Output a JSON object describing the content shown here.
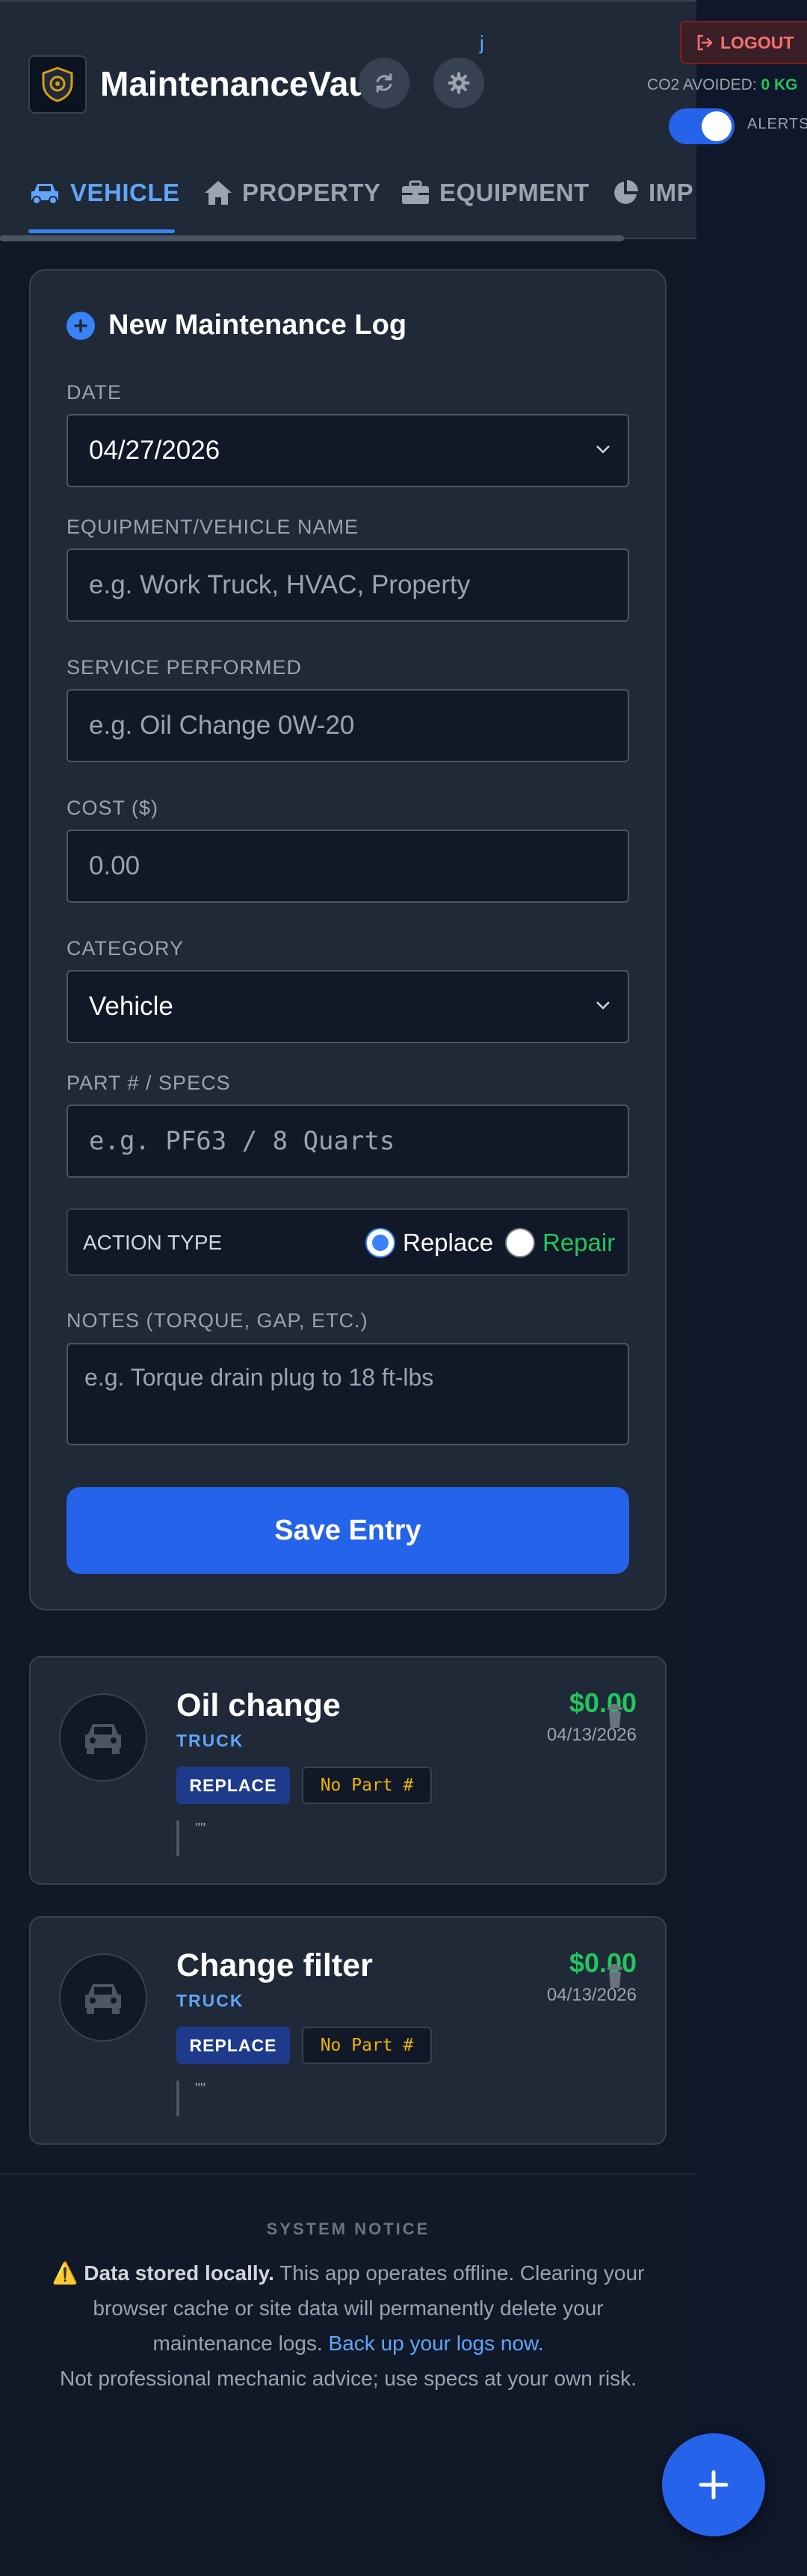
{
  "header": {
    "app_title": "MaintenanceVault",
    "user_initial": "j",
    "logout_label": "LOGOUT",
    "co2_label": "CO2 AVOIDED:",
    "co2_value": "0 KG",
    "alerts_label": "ALERTS",
    "alerts_enabled": true
  },
  "tabs": [
    {
      "label": "VEHICLE",
      "icon": "car-icon",
      "active": true
    },
    {
      "label": "PROPERTY",
      "icon": "home-icon",
      "active": false
    },
    {
      "label": "EQUIPMENT",
      "icon": "toolbox-icon",
      "active": false
    },
    {
      "label": "IMP",
      "icon": "pie-chart-icon",
      "active": false
    }
  ],
  "form": {
    "title": "New Maintenance Log",
    "date_label": "DATE",
    "date_value": "04/27/2026",
    "name_label": "EQUIPMENT/VEHICLE NAME",
    "name_placeholder": "e.g. Work Truck, HVAC, Property",
    "service_label": "SERVICE PERFORMED",
    "service_placeholder": "e.g. Oil Change 0W-20",
    "cost_label": "COST ($)",
    "cost_placeholder": "0.00",
    "category_label": "CATEGORY",
    "category_value": "Vehicle",
    "part_label": "PART # / SPECS",
    "part_placeholder": "e.g. PF63 / 8 Quarts",
    "action_label": "ACTION TYPE",
    "action_replace": "Replace",
    "action_repair": "Repair",
    "action_selected": "Replace",
    "notes_label": "NOTES (TORQUE, GAP, ETC.)",
    "notes_placeholder": "e.g. Torque drain plug to 18 ft-lbs",
    "save_label": "Save Entry"
  },
  "logs": [
    {
      "title": "Oil change",
      "category": "TRUCK",
      "price": "$0.00",
      "date": "04/13/2026",
      "action": "REPLACE",
      "part": "No Part #",
      "notes": "\"\""
    },
    {
      "title": "Change filter",
      "category": "TRUCK",
      "price": "$0.00",
      "date": "04/13/2026",
      "action": "REPLACE",
      "part": "No Part #",
      "notes": "\"\""
    }
  ],
  "footer": {
    "notice_title": "SYSTEM NOTICE",
    "notice_bold": "Data stored locally.",
    "notice_text": " This app operates offline. Clearing your browser cache or site data will permanently delete your maintenance logs. ",
    "notice_link": "Back up your logs now.",
    "disclaimer": "Not professional mechanic advice; use specs at your own risk."
  },
  "colors": {
    "accent": "#2563eb",
    "success": "#22c55e",
    "danger": "#f87171",
    "warning": "#eab308"
  }
}
